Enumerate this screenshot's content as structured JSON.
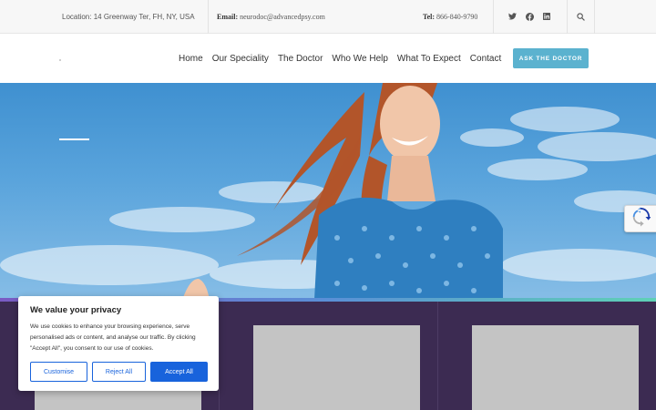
{
  "topbar": {
    "location": "Location: 14 Greenway Ter, FH, NY, USA",
    "email_label": "Email:",
    "email": "neurodoc@advancedpsy.com",
    "tel_label": "Tel:",
    "tel": "866-840-9790",
    "social_icons": [
      "twitter-icon",
      "facebook-icon",
      "linkedin-icon"
    ],
    "search_icon": "search-icon"
  },
  "nav": {
    "items": [
      "Home",
      "Our Speciality",
      "The Doctor",
      "Who We Help",
      "What To Expect",
      "Contact"
    ],
    "cta": "ASK THE DOCTOR"
  },
  "cookie": {
    "title": "We value your privacy",
    "body": "We use cookies to enhance your browsing experience, serve personalised ads or content, and analyse our traffic. By clicking \"Accept All\", you consent to our use of cookies.",
    "customise": "Customise",
    "reject": "Reject All",
    "accept": "Accept All"
  },
  "colors": {
    "accent": "#5bb2cf",
    "cookie_primary": "#1863dc",
    "lower_bg": "#3c2b52"
  }
}
